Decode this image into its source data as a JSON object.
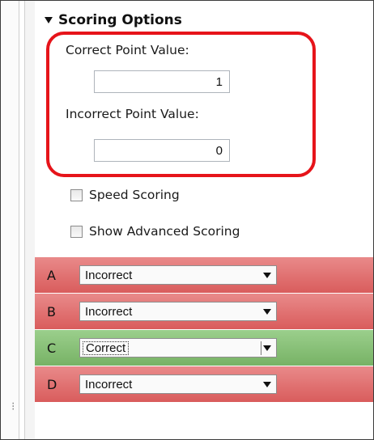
{
  "section": {
    "title": "Scoring Options"
  },
  "correct_point": {
    "label": "Correct Point Value:",
    "value": "1"
  },
  "incorrect_point": {
    "label": "Incorrect Point Value:",
    "value": "0"
  },
  "options": {
    "speed_scoring": {
      "label": "Speed Scoring",
      "checked": false
    },
    "advanced_scoring": {
      "label": "Show Advanced Scoring",
      "checked": false
    }
  },
  "answers": [
    {
      "letter": "A",
      "value": "Incorrect",
      "status": "incorrect"
    },
    {
      "letter": "B",
      "value": "Incorrect",
      "status": "incorrect"
    },
    {
      "letter": "C",
      "value": "Correct",
      "status": "correct"
    },
    {
      "letter": "D",
      "value": "Incorrect",
      "status": "incorrect"
    }
  ],
  "colors": {
    "highlight": "#e6141a",
    "incorrect_row": "#de6868",
    "correct_row": "#84bd72"
  },
  "icons": {
    "collapse": "triangle-down-icon",
    "dropdown": "chevron-down-icon"
  }
}
